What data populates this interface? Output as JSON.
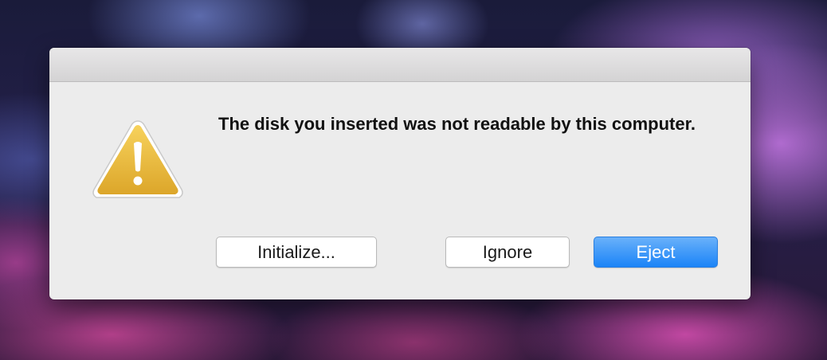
{
  "dialog": {
    "message": "The disk you inserted was not readable by this computer.",
    "icon": "warning-triangle-icon",
    "buttons": {
      "initialize": "Initialize...",
      "ignore": "Ignore",
      "eject": "Eject"
    },
    "default_button": "eject"
  },
  "colors": {
    "dialog_background": "#ececec",
    "default_button": "#1b84f7",
    "warning_icon": "#e8b936"
  }
}
